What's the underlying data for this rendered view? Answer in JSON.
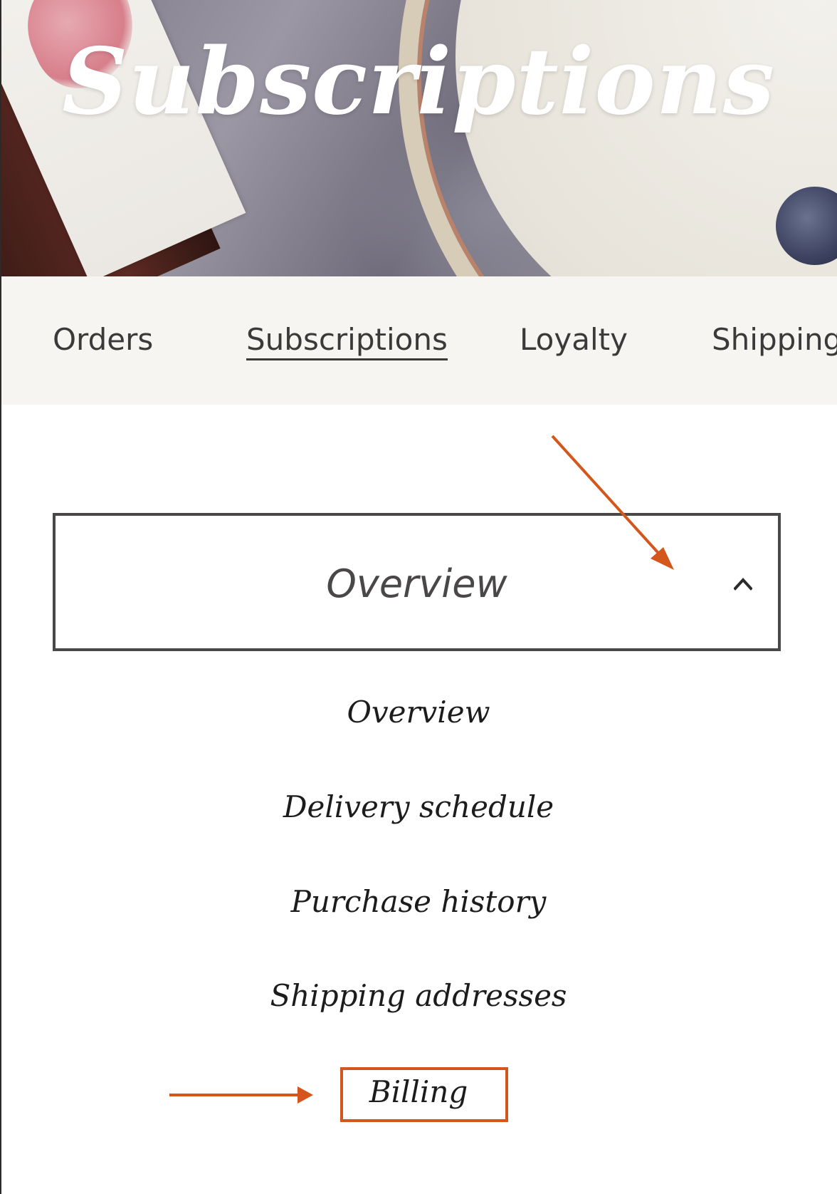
{
  "hero": {
    "title": "Subscriptions"
  },
  "tabs": [
    {
      "label": "Orders",
      "active": false
    },
    {
      "label": "Subscriptions",
      "active": true
    },
    {
      "label": "Loyalty",
      "active": false
    },
    {
      "label": "Shipping",
      "active": false
    }
  ],
  "dropdown": {
    "selected": "Overview",
    "icon": "chevron-up-icon",
    "expanded": true
  },
  "menu": {
    "items": [
      {
        "label": "Overview"
      },
      {
        "label": "Delivery schedule"
      },
      {
        "label": "Purchase history"
      },
      {
        "label": "Shipping addresses"
      },
      {
        "label": "Billing",
        "highlighted": true
      }
    ]
  },
  "annotation": {
    "color": "#d4561c"
  },
  "colors": {
    "tab_bar_bg": "#f6f5f1",
    "border": "#4a4748",
    "text": "#3a3a3a"
  }
}
